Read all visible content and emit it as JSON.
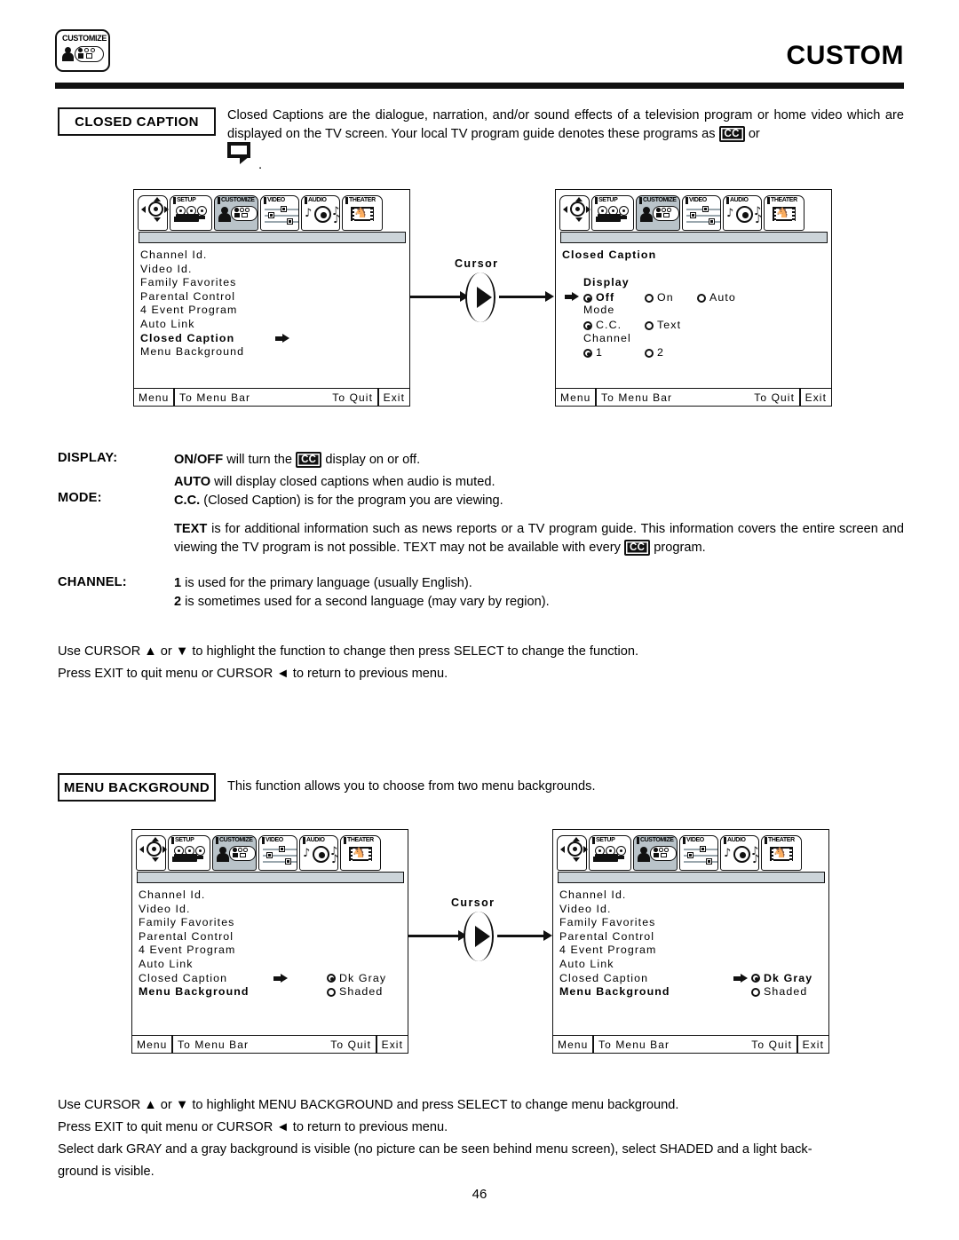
{
  "header": {
    "title": "CUSTOM",
    "badge_label": "CUSTOMIZE",
    "badge_icon": "customize-person-panel-icon"
  },
  "closed_caption": {
    "label": "CLOSED CAPTION",
    "para_part1": "Closed Captions are the dialogue, narration, and/or sound effects of a television program or home video which are displayed on the TV screen.  Your local TV program guide denotes these programs as ",
    "cc_badge": "CC",
    "para_part2": " or",
    "balloon_period": "."
  },
  "menu_bar": {
    "tabs": [
      {
        "name": "",
        "icon": "cursor-pad-icon",
        "selected": false
      },
      {
        "name": "SETUP",
        "icon": "camera-icon",
        "selected": false
      },
      {
        "name": "CUSTOMIZE",
        "icon": "customize-person-panel-icon",
        "selected": true
      },
      {
        "name": "VIDEO",
        "icon": "sliders-icon",
        "selected": false
      },
      {
        "name": "AUDIO",
        "icon": "speaker-notes-icon",
        "selected": false
      },
      {
        "name": "THEATER",
        "icon": "film-horse-icon",
        "selected": false
      }
    ]
  },
  "footer_bar": {
    "menu": "Menu",
    "to_menu_bar": "To Menu Bar",
    "to_quit": "To Quit",
    "exit": "Exit"
  },
  "screen_custom_menu": {
    "items": [
      {
        "label": "Channel Id.",
        "bold": false,
        "arrow": false
      },
      {
        "label": "Video Id.",
        "bold": false,
        "arrow": false
      },
      {
        "label": "Family Favorites",
        "bold": false,
        "arrow": false
      },
      {
        "label": "Parental Control",
        "bold": false,
        "arrow": false
      },
      {
        "label": "4 Event Program",
        "bold": false,
        "arrow": false
      },
      {
        "label": "Auto Link",
        "bold": false,
        "arrow": false
      },
      {
        "label": "Closed Caption",
        "bold": true,
        "arrow": true
      },
      {
        "label": "Menu Background",
        "bold": false,
        "arrow": false
      }
    ]
  },
  "screen_closed_caption": {
    "title": "Closed Caption",
    "groups": [
      {
        "heading": "Display",
        "options": [
          {
            "label": "Off",
            "selected": true,
            "bold": true
          },
          {
            "label": "On",
            "selected": false,
            "bold": false
          },
          {
            "label": "Auto",
            "selected": false,
            "bold": false
          }
        ]
      },
      {
        "heading": "Mode",
        "options": [
          {
            "label": "C.C.",
            "selected": true,
            "bold": false
          },
          {
            "label": "Text",
            "selected": false,
            "bold": false
          }
        ]
      },
      {
        "heading": "Channel",
        "options": [
          {
            "label": "1",
            "selected": true,
            "bold": false
          },
          {
            "label": "2",
            "selected": false,
            "bold": false
          }
        ]
      }
    ]
  },
  "flow1": {
    "cursor_label": "Cursor"
  },
  "flow2": {
    "cursor_label": "Cursor"
  },
  "definitions": {
    "display_term": "DISPLAY:",
    "display_body_a": "ON/OFF",
    "display_body_b": " will turn the ",
    "display_badge": "CC",
    "display_body_c": " display on or off.",
    "mode_term": "MODE:",
    "mode_line1_bold": "AUTO",
    "mode_line1_rest": " will display closed captions when audio is muted.",
    "mode_line2_bold": "C.C.",
    "mode_line2_rest": " (Closed Caption) is for the program you are viewing.",
    "text_bold": "TEXT",
    "text_rest1": " is for additional information such as news reports or a TV program guide.  This information covers the entire screen and viewing the TV program is not possible.  TEXT may not be available with every ",
    "text_badge": "CC",
    "text_rest2": " program.",
    "channel_term": "CHANNEL:",
    "channel_line1_bold": "1",
    "channel_line1_rest": " is used for the primary language (usually English).",
    "channel_line2_bold": "2",
    "channel_line2_rest": " is sometimes used for a second language (may vary by region)."
  },
  "instructions_cc": {
    "line1": "Use CURSOR ▲ or ▼ to highlight the function to change then press SELECT to change the function.",
    "line2": "Press EXIT to quit menu or CURSOR ◄ to return to previous menu."
  },
  "menu_background": {
    "label": "MENU BACKGROUND",
    "para": "This function allows you to choose from two menu backgrounds."
  },
  "screen_mb_left": {
    "items": [
      {
        "label": "Channel Id.",
        "bold": false
      },
      {
        "label": "Video Id.",
        "bold": false
      },
      {
        "label": "Family Favorites",
        "bold": false
      },
      {
        "label": "Parental Control",
        "bold": false
      },
      {
        "label": "4 Event Program",
        "bold": false
      },
      {
        "label": "Auto Link",
        "bold": false
      },
      {
        "label": "Closed Caption",
        "bold": false
      },
      {
        "label": "Menu Background",
        "bold": true
      }
    ],
    "options": [
      {
        "label": "Dk Gray",
        "selected": true
      },
      {
        "label": "Shaded",
        "selected": false
      }
    ]
  },
  "screen_mb_right": {
    "items": [
      {
        "label": "Channel Id.",
        "bold": false
      },
      {
        "label": "Video Id.",
        "bold": false
      },
      {
        "label": "Family Favorites",
        "bold": false
      },
      {
        "label": "Parental Control",
        "bold": false
      },
      {
        "label": "4 Event Program",
        "bold": false
      },
      {
        "label": "Auto Link",
        "bold": false
      },
      {
        "label": "Closed Caption",
        "bold": false
      },
      {
        "label": "Menu Background",
        "bold": true
      }
    ],
    "options": [
      {
        "label": "Dk Gray",
        "selected": true,
        "bold": true
      },
      {
        "label": "Shaded",
        "selected": false,
        "bold": false
      }
    ]
  },
  "instructions_mb": {
    "line1": "Use CURSOR ▲ or ▼ to highlight MENU BACKGROUND and press SELECT to change menu background.",
    "line2": "Press EXIT to quit menu or CURSOR ◄ to return to previous menu.",
    "line3": "Select dark GRAY and a gray background is visible (no picture can be seen behind menu screen), select SHADED and a light back-",
    "line4": "ground is visible."
  },
  "page_number": "46"
}
